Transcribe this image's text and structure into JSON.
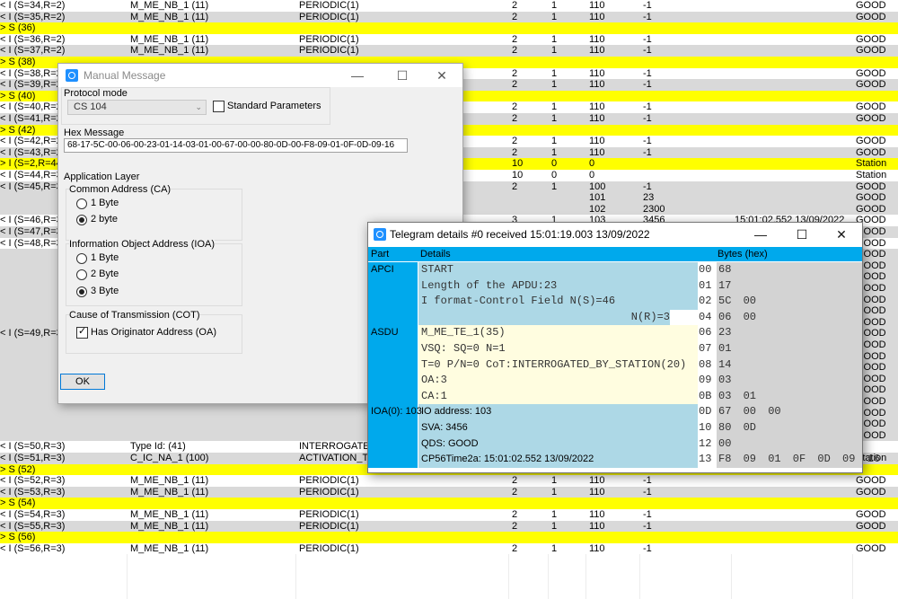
{
  "log_rows": [
    {
      "c": "white",
      "cols": [
        "< I (S=34,R=2)",
        "M_ME_NB_1 (11)",
        "PERIODIC(1)",
        "2",
        "1",
        "110",
        "-1",
        "",
        "GOOD"
      ]
    },
    {
      "c": "gray",
      "cols": [
        "< I (S=35,R=2)",
        "M_ME_NB_1 (11)",
        "PERIODIC(1)",
        "2",
        "1",
        "110",
        "-1",
        "",
        "GOOD"
      ]
    },
    {
      "c": "yellow",
      "cols": [
        "> S (36)",
        "",
        "",
        "",
        "",
        "",
        "",
        "",
        ""
      ]
    },
    {
      "c": "white",
      "cols": [
        "< I (S=36,R=2)",
        "M_ME_NB_1 (11)",
        "PERIODIC(1)",
        "2",
        "1",
        "110",
        "-1",
        "",
        "GOOD"
      ]
    },
    {
      "c": "gray",
      "cols": [
        "< I (S=37,R=2)",
        "M_ME_NB_1 (11)",
        "PERIODIC(1)",
        "2",
        "1",
        "110",
        "-1",
        "",
        "GOOD"
      ]
    },
    {
      "c": "yellow",
      "cols": [
        "> S (38)",
        "",
        "",
        "",
        "",
        "",
        "",
        "",
        ""
      ]
    },
    {
      "c": "white",
      "cols": [
        "< I (S=38,R=2)",
        "M_ME_NB_1 (11)",
        "PERIODIC(1)",
        "2",
        "1",
        "110",
        "-1",
        "",
        "GOOD"
      ]
    },
    {
      "c": "gray",
      "cols": [
        "< I (S=39,R=2)",
        "M_ME_NB_1 (11)",
        "PERIODIC(1)",
        "2",
        "1",
        "110",
        "-1",
        "",
        "GOOD"
      ]
    },
    {
      "c": "yellow",
      "cols": [
        "> S (40)",
        "",
        "",
        "",
        "",
        "",
        "",
        "",
        ""
      ]
    },
    {
      "c": "white",
      "cols": [
        "< I (S=40,R=2)",
        "M_ME_NB_1 (11)",
        "PERIODIC(1)",
        "2",
        "1",
        "110",
        "-1",
        "",
        "GOOD"
      ]
    },
    {
      "c": "gray",
      "cols": [
        "< I (S=41,R=2)",
        "M_ME_NB_1 (11)",
        "PERIODIC(1)",
        "2",
        "1",
        "110",
        "-1",
        "",
        "GOOD"
      ]
    },
    {
      "c": "yellow",
      "cols": [
        "> S (42)",
        "",
        "",
        "",
        "",
        "",
        "",
        "",
        ""
      ]
    },
    {
      "c": "white",
      "cols": [
        "< I (S=42,R=2)",
        "M_ME_NB_1 (11)",
        "PERIODIC(1)",
        "2",
        "1",
        "110",
        "-1",
        "",
        "GOOD"
      ]
    },
    {
      "c": "gray",
      "cols": [
        "< I (S=43,R=2)",
        "M_ME_NB_1 (11)",
        "PERIODIC(1)",
        "2",
        "1",
        "110",
        "-1",
        "",
        "GOOD"
      ]
    },
    {
      "c": "yellow",
      "cols": [
        "> I (S=2,R=44)",
        "",
        "",
        "10",
        "0",
        "0",
        "",
        "",
        "Station"
      ]
    },
    {
      "c": "white",
      "cols": [
        "< I (S=44,R=3)",
        "",
        "",
        "10",
        "0",
        "0",
        "",
        "",
        "Station"
      ]
    },
    {
      "c": "gray",
      "cols": [
        "< I (S=45,R=3)",
        "",
        "",
        "2",
        "1",
        "100",
        "-1",
        "",
        "GOOD"
      ]
    },
    {
      "c": "gray",
      "cols": [
        "",
        "",
        "",
        "",
        "",
        "101",
        "23",
        "",
        "GOOD"
      ]
    },
    {
      "c": "gray",
      "cols": [
        "",
        "",
        "",
        "",
        "",
        "102",
        "2300",
        "",
        "GOOD"
      ]
    },
    {
      "c": "white",
      "cols": [
        "< I (S=46,R=3)",
        "",
        "",
        "3",
        "1",
        "103",
        "3456",
        "15:01:02.552 13/09/2022",
        "GOOD"
      ]
    },
    {
      "c": "gray",
      "cols": [
        "< I (S=47,R=3)",
        "",
        "",
        "",
        "",
        "",
        "",
        "",
        "GOOD"
      ]
    },
    {
      "c": "white",
      "cols": [
        "< I (S=48,R=3)",
        "",
        "",
        "",
        "",
        "",
        "",
        "",
        "GOOD"
      ]
    },
    {
      "c": "gray",
      "cols": [
        "",
        "",
        "",
        "",
        "",
        "",
        "",
        "",
        "GOOD"
      ]
    },
    {
      "c": "gray",
      "cols": [
        "",
        "",
        "",
        "",
        "",
        "",
        "",
        "",
        "GOOD"
      ]
    },
    {
      "c": "gray",
      "cols": [
        "",
        "",
        "",
        "",
        "",
        "",
        "",
        "",
        "GOOD"
      ]
    },
    {
      "c": "gray",
      "cols": [
        "",
        "",
        "",
        "",
        "",
        "",
        "",
        "",
        "GOOD"
      ]
    },
    {
      "c": "gray",
      "cols": [
        "",
        "",
        "",
        "",
        "",
        "",
        "",
        "",
        "GOOD"
      ]
    },
    {
      "c": "gray",
      "cols": [
        "",
        "",
        "",
        "",
        "",
        "",
        "",
        "",
        "GOOD"
      ]
    },
    {
      "c": "gray",
      "cols": [
        "",
        "",
        "",
        "",
        "",
        "",
        "",
        "",
        "GOOD"
      ]
    },
    {
      "c": "gray",
      "cols": [
        "< I (S=49,R=3)",
        "",
        "",
        "",
        "",
        "",
        "",
        "",
        "GOOD"
      ]
    },
    {
      "c": "gray",
      "cols": [
        "",
        "",
        "",
        "",
        "",
        "",
        "",
        "",
        "GOOD"
      ]
    },
    {
      "c": "gray",
      "cols": [
        "",
        "",
        "",
        "",
        "",
        "",
        "",
        "",
        "GOOD"
      ]
    },
    {
      "c": "gray",
      "cols": [
        "",
        "",
        "",
        "",
        "",
        "",
        "",
        "",
        "GOOD"
      ]
    },
    {
      "c": "gray",
      "cols": [
        "",
        "",
        "",
        "",
        "",
        "",
        "",
        "",
        "GOOD"
      ]
    },
    {
      "c": "gray",
      "cols": [
        "",
        "",
        "",
        "",
        "",
        "",
        "",
        "",
        "GOOD"
      ]
    },
    {
      "c": "gray",
      "cols": [
        "",
        "",
        "",
        "",
        "",
        "",
        "",
        "",
        "GOOD"
      ]
    },
    {
      "c": "gray",
      "cols": [
        "",
        "",
        "",
        "",
        "",
        "",
        "",
        "",
        "GOOD"
      ]
    },
    {
      "c": "gray",
      "cols": [
        "",
        "",
        "",
        "",
        "",
        "",
        "",
        "",
        "GOOD"
      ]
    },
    {
      "c": "gray",
      "cols": [
        "",
        "",
        "",
        "",
        "",
        "",
        "",
        "",
        "GOOD"
      ]
    },
    {
      "c": "white",
      "cols": [
        "< I (S=50,R=3)",
        "Type Id: (41)",
        "INTERROGATED",
        "",
        "",
        "",
        "",
        "",
        ""
      ]
    },
    {
      "c": "gray",
      "cols": [
        "< I (S=51,R=3)",
        "C_IC_NA_1 (100)",
        "ACTIVATION_TE",
        "",
        "",
        "",
        "",
        "",
        "Station"
      ]
    },
    {
      "c": "yellow",
      "cols": [
        "> S (52)",
        "",
        "",
        "",
        "",
        "",
        "",
        "",
        ""
      ]
    },
    {
      "c": "white",
      "cols": [
        "< I (S=52,R=3)",
        "M_ME_NB_1 (11)",
        "PERIODIC(1)",
        "2",
        "1",
        "110",
        "-1",
        "",
        "GOOD"
      ]
    },
    {
      "c": "gray",
      "cols": [
        "< I (S=53,R=3)",
        "M_ME_NB_1 (11)",
        "PERIODIC(1)",
        "2",
        "1",
        "110",
        "-1",
        "",
        "GOOD"
      ]
    },
    {
      "c": "yellow",
      "cols": [
        "> S (54)",
        "",
        "",
        "",
        "",
        "",
        "",
        "",
        ""
      ]
    },
    {
      "c": "white",
      "cols": [
        "< I (S=54,R=3)",
        "M_ME_NB_1 (11)",
        "PERIODIC(1)",
        "2",
        "1",
        "110",
        "-1",
        "",
        "GOOD"
      ]
    },
    {
      "c": "gray",
      "cols": [
        "< I (S=55,R=3)",
        "M_ME_NB_1 (11)",
        "PERIODIC(1)",
        "2",
        "1",
        "110",
        "-1",
        "",
        "GOOD"
      ]
    },
    {
      "c": "yellow",
      "cols": [
        "> S (56)",
        "",
        "",
        "",
        "",
        "",
        "",
        "",
        ""
      ]
    },
    {
      "c": "white",
      "cols": [
        "< I (S=56,R=3)",
        "M_ME_NB_1 (11)",
        "PERIODIC(1)",
        "2",
        "1",
        "110",
        "-1",
        "",
        "GOOD"
      ]
    }
  ],
  "manual_message": {
    "title": "Manual Message",
    "protocol_mode_label": "Protocol mode",
    "protocol_mode_value": "CS 104",
    "standard_params_label": "Standard Parameters",
    "standard_params_checked": false,
    "hex_label": "Hex Message",
    "hex_value": "68-17-5C-00-06-00-23-01-14-03-01-00-67-00-00-80-0D-00-F8-09-01-0F-0D-09-16",
    "app_layer_label": "Application Layer",
    "ca_label": "Common Address (CA)",
    "ca_opt1": "1 Byte",
    "ca_opt2": "2 byte",
    "ioa_label": "Information Object Address (IOA)",
    "ioa_opt1": "1 Byte",
    "ioa_opt2": "2 Byte",
    "ioa_opt3": "3 Byte",
    "cot_label": "Cause of Transmission (COT)",
    "oa_label": "Has Originator Address (OA)",
    "oa_checked": true,
    "ok_label": "OK"
  },
  "telegram": {
    "title": "Telegram details #0 received 15:01:19.003 13/09/2022",
    "col_part": "Part",
    "col_details": "Details",
    "col_bytes": "Bytes (hex)",
    "rows": [
      {
        "part": "APCI",
        "detail": "START",
        "idx": "00",
        "bytes": "68",
        "section": "apci",
        "mono": true
      },
      {
        "part": "",
        "detail": "Length of the APDU:23",
        "idx": "01",
        "bytes": "17",
        "section": "apci",
        "mono": true
      },
      {
        "part": "",
        "detail": "I format-Control Field N(S)=46",
        "idx": "02",
        "bytes": "5C 00",
        "section": "apci",
        "mono": true
      },
      {
        "part": "",
        "detail": "N(R)=3",
        "idx": "04",
        "bytes": "06 00",
        "section": "apci",
        "mono": true,
        "right": true
      },
      {
        "part": "ASDU",
        "detail": "M_ME_TE_1(35)",
        "idx": "06",
        "bytes": "23",
        "section": "asdu",
        "mono": true
      },
      {
        "part": "",
        "detail": "VSQ: SQ=0 N=1",
        "idx": "07",
        "bytes": "01",
        "section": "asdu",
        "mono": true
      },
      {
        "part": "",
        "detail": "T=0 P/N=0 CoT:INTERROGATED_BY_STATION(20)",
        "idx": "08",
        "bytes": "14",
        "section": "asdu",
        "mono": true
      },
      {
        "part": "",
        "detail": "OA:3",
        "idx": "09",
        "bytes": "03",
        "section": "asdu",
        "mono": true
      },
      {
        "part": "",
        "detail": "CA:1",
        "idx": "0B",
        "bytes": "03 01",
        "section": "asdu",
        "mono": true
      },
      {
        "part": "IOA(0): 103",
        "detail": "IO address: 103",
        "idx": "0D",
        "bytes": "67 00 00",
        "section": "ioa",
        "mono": false
      },
      {
        "part": "",
        "detail": "SVA: 3456",
        "idx": "10",
        "bytes": "80 0D",
        "section": "ioa",
        "mono": false
      },
      {
        "part": "",
        "detail": "QDS: GOOD",
        "idx": "12",
        "bytes": "00",
        "section": "ioa",
        "mono": false
      },
      {
        "part": "",
        "detail": "CP56Time2a: 15:01:02.552 13/09/2022",
        "idx": "13",
        "bytes": "F8 09 01 0F 0D 09 16",
        "section": "ioa",
        "mono": false
      }
    ]
  },
  "colors": {
    "header_blue": "#00a9ec",
    "apci_bg": "#add8e6",
    "asdu_bg": "#fffde0",
    "ioa_bg": "#add8e6",
    "bytes_bg": "#d3d3d3",
    "yellow_row": "#ffff00",
    "gray_row": "#d9d9d9"
  }
}
